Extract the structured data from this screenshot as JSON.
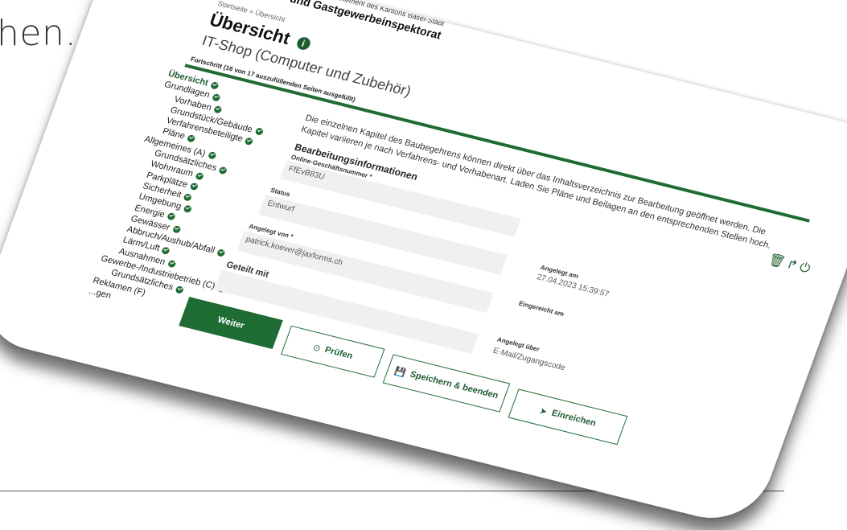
{
  "slide": {
    "heading": "hen…"
  },
  "header": {
    "dept_line": "Bau- und Verkehrsdepartement des Kantons Basel-Stadt",
    "org_name": "Bau- und Gastgewerbeinspektorat",
    "breadcrumb": "Startseite » Übersicht",
    "page_title": "Übersicht",
    "info_icon_glyph": "i",
    "subtitle": "IT-Shop (Computer und Zubehör)",
    "progress_label": "Fortschritt (16 von 17 auszufüllenden Seiten ausgefüllt)",
    "progress": {
      "done": 16,
      "total": 17
    }
  },
  "toolbar_icons": [
    "trash-icon",
    "share-icon",
    "power-icon"
  ],
  "sidebar": {
    "items": [
      {
        "label": "Übersicht",
        "level": 0,
        "done": true,
        "active": true
      },
      {
        "label": "Grundlagen",
        "level": 0,
        "done": true
      },
      {
        "label": "Vorhaben",
        "level": 1,
        "done": true
      },
      {
        "label": "Grundstück/Gebäude",
        "level": 1,
        "done": true
      },
      {
        "label": "Verfahrensbeteiligte",
        "level": 1,
        "done": true
      },
      {
        "label": "Pläne",
        "level": 1,
        "done": true
      },
      {
        "label": "Allgemeines (A)",
        "level": 0,
        "done": true
      },
      {
        "label": "Grundsätzliches",
        "level": 1,
        "done": true
      },
      {
        "label": "Wohnraum",
        "level": 1,
        "done": true
      },
      {
        "label": "Parkplätze",
        "level": 1,
        "done": true
      },
      {
        "label": "Sicherheit",
        "level": 1,
        "done": true
      },
      {
        "label": "Umgebung",
        "level": 1,
        "done": true
      },
      {
        "label": "Energie",
        "level": 1,
        "done": true
      },
      {
        "label": "Gewässer",
        "level": 1,
        "done": true
      },
      {
        "label": "Abbruch/Aushub/Abfall",
        "level": 1,
        "done": true
      },
      {
        "label": "Lärm/Luft",
        "level": 1,
        "done": true
      },
      {
        "label": "Ausnahmen",
        "level": 1,
        "done": true
      },
      {
        "label": "Gewerbe-/Industriebetrieb (C)",
        "level": 0,
        "done": true
      },
      {
        "label": "Grundsätzliches",
        "level": 1,
        "done": true
      },
      {
        "label": "Reklamen (F)",
        "level": 0,
        "done": false
      },
      {
        "label": "...gen",
        "level": 0,
        "done": false
      }
    ]
  },
  "main": {
    "intro": "Die einzelnen Kapitel des Baubegehrens können direkt über das Inhaltsverzeichnis zur Bearbeitung geöffnet werden. Die Kapitel variieren je nach Verfahrens- und Vorhabenart. Laden Sie Pläne und Beilagen an den entsprechenden Stellen hoch.",
    "section_title": "Bearbeitungsinformationen",
    "fields": {
      "business_number_label": "Online-Geschäftsnummer *",
      "business_number_value": "FfEvB83U",
      "status_label": "Status",
      "status_value": "Entwurf",
      "created_by_label": "Angelegt von *",
      "created_by_value": "patrick.koever@jaxforms.ch",
      "shared_with_label": "Geteilt mit",
      "shared_with_value": ""
    },
    "meta": {
      "created_at_label": "Angelegt am",
      "created_at_value": "27.04.2023 15:39:57",
      "submitted_at_label": "Eingereicht am",
      "submitted_at_value": "",
      "created_via_label": "Angelegt über",
      "created_via_value": "E-Mail/Zugangscode"
    }
  },
  "buttons": {
    "next": "Weiter",
    "check": "Prüfen",
    "check_icon": "check-circle-icon",
    "save_exit": "Speichern & beenden",
    "save_icon": "save-icon",
    "submit": "Einreichen",
    "submit_icon": "send-icon"
  },
  "colors": {
    "accent": "#1f6b34",
    "accent_dark": "#1f5d31"
  }
}
